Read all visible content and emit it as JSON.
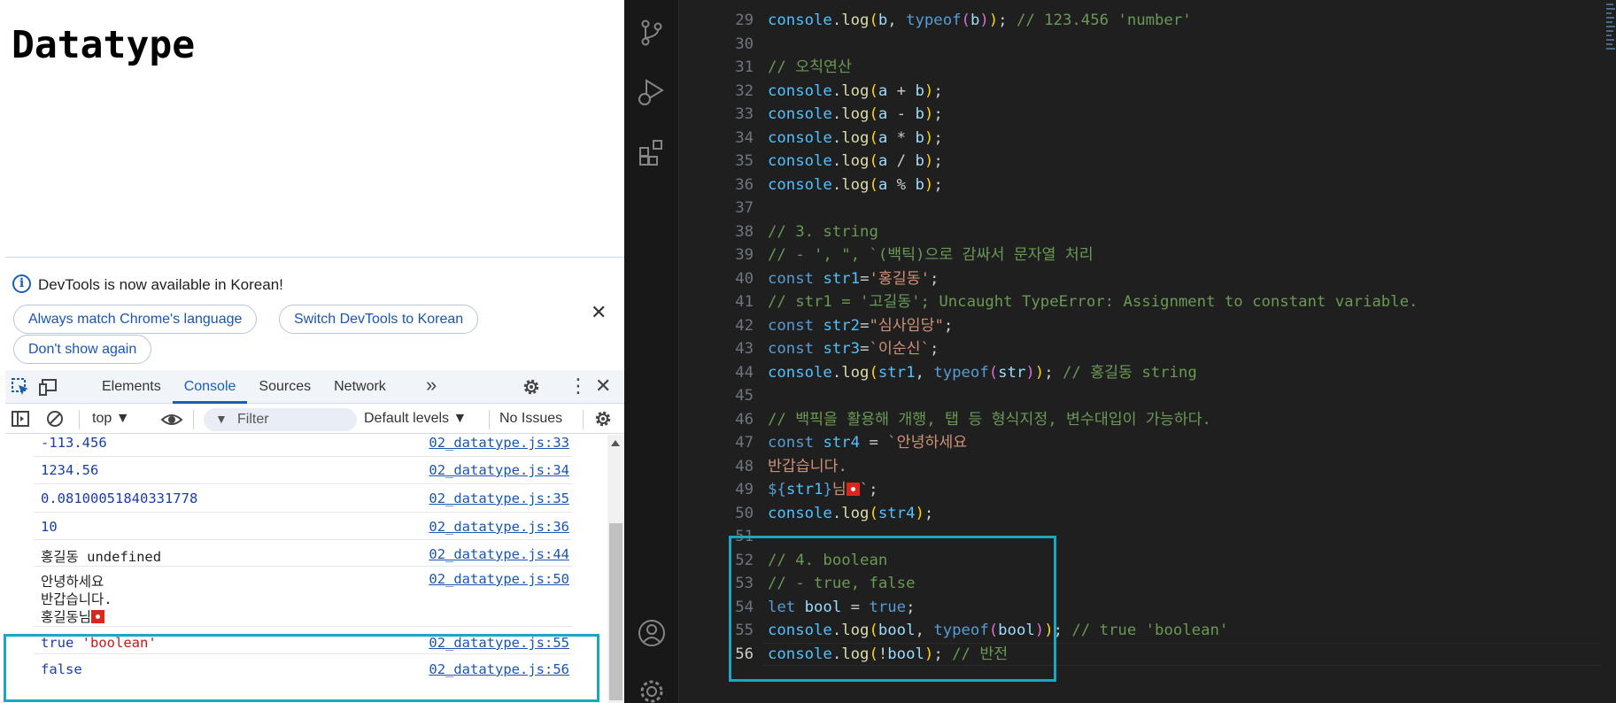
{
  "browser": {
    "page_heading": "Datatype"
  },
  "devtools": {
    "infobar": {
      "message": "DevTools is now available in Korean!",
      "btn_always": "Always match Chrome's language",
      "btn_switch": "Switch DevTools to Korean",
      "btn_dont": "Don't show again"
    },
    "tabs": [
      "Elements",
      "Console",
      "Sources",
      "Network"
    ],
    "active_tab": "Console",
    "filterbar": {
      "context": "top ▼",
      "filter_placeholder": "Filter",
      "levels": "Default levels ▼",
      "issues": "No Issues"
    },
    "console_rows": [
      {
        "text": "-113.456",
        "source": "02_datatype.js:33"
      },
      {
        "text": "1234.56",
        "source": "02_datatype.js:34"
      },
      {
        "text": "0.08100051840331778",
        "source": "02_datatype.js:35"
      },
      {
        "text": "10",
        "source": "02_datatype.js:36"
      },
      {
        "text": "홍길동 undefined",
        "source": "02_datatype.js:44"
      },
      {
        "line1": "안녕하세요",
        "line2": "반갑습니다.",
        "line3": "홍길동님",
        "source": "02_datatype.js:50"
      },
      {
        "text_bool": "true",
        "text_str": "'boolean'",
        "source": "02_datatype.js:55"
      },
      {
        "text": "false",
        "source": "02_datatype.js:56"
      }
    ]
  },
  "editor": {
    "lines": [
      {
        "n": "29",
        "html": "<span class='cv'>console</span>.<span class='fn'>log</span><span class='p1'>(</span><span class='vr'>b</span>, <span class='tp'>typeof</span><span class='p2'>(</span><span class='vr'>b</span><span class='p2'>)</span><span class='p1'>)</span>; <span class='cm'>// 123.456 'number'</span>"
      },
      {
        "n": "30",
        "html": ""
      },
      {
        "n": "31",
        "html": "<span class='cm'>// 오칙연산</span>"
      },
      {
        "n": "32",
        "html": "<span class='cv'>console</span>.<span class='fn'>log</span><span class='p1'>(</span><span class='vr'>a</span> + <span class='vr'>b</span><span class='p1'>)</span>;"
      },
      {
        "n": "33",
        "html": "<span class='cv'>console</span>.<span class='fn'>log</span><span class='p1'>(</span><span class='vr'>a</span> - <span class='vr'>b</span><span class='p1'>)</span>;"
      },
      {
        "n": "34",
        "html": "<span class='cv'>console</span>.<span class='fn'>log</span><span class='p1'>(</span><span class='vr'>a</span> * <span class='vr'>b</span><span class='p1'>)</span>;"
      },
      {
        "n": "35",
        "html": "<span class='cv'>console</span>.<span class='fn'>log</span><span class='p1'>(</span><span class='vr'>a</span> / <span class='vr'>b</span><span class='p1'>)</span>;"
      },
      {
        "n": "36",
        "html": "<span class='cv'>console</span>.<span class='fn'>log</span><span class='p1'>(</span><span class='vr'>a</span> % <span class='vr'>b</span><span class='p1'>)</span>;"
      },
      {
        "n": "37",
        "html": ""
      },
      {
        "n": "38",
        "html": "<span class='cm'>// 3. string</span>"
      },
      {
        "n": "39",
        "html": "<span class='cm'>// - ', \", `(백틱)으로 감싸서 문자열 처리</span>"
      },
      {
        "n": "40",
        "html": "<span class='kw'>const</span> <span class='cv'>str1</span>=<span class='st'>'홍길동'</span>;"
      },
      {
        "n": "41",
        "html": "<span class='cm'>// str1 = '고길동'; Uncaught TypeError: Assignment to constant variable.</span>"
      },
      {
        "n": "42",
        "html": "<span class='kw'>const</span> <span class='cv'>str2</span>=<span class='st'>\"심사임당\"</span>;"
      },
      {
        "n": "43",
        "html": "<span class='kw'>const</span> <span class='cv'>str3</span>=<span class='st'>`이순신`</span>;"
      },
      {
        "n": "44",
        "html": "<span class='cv'>console</span>.<span class='fn'>log</span><span class='p1'>(</span><span class='cv'>str1</span>, <span class='tp'>typeof</span><span class='p2'>(</span><span class='vr'>str</span><span class='p2'>)</span><span class='p1'>)</span>; <span class='cm'>// 홍길동 string</span>"
      },
      {
        "n": "45",
        "html": ""
      },
      {
        "n": "46",
        "html": "<span class='cm'>// 백픽을 활용해 개행, 탭 등 형식지정, 변수대입이 가능하다.</span>"
      },
      {
        "n": "47",
        "html": "<span class='kw'>const</span> <span class='cv'>str4</span> = <span class='st'>`안녕하세요</span>"
      },
      {
        "n": "48",
        "html": "<span class='st'>반갑습니다.</span>"
      },
      {
        "n": "49",
        "html": "<span class='kw'>${</span><span class='cv'>str1</span><span class='kw'>}</span><span class='st'>님</span><span class='flag'></span><span class='st'>`</span>;"
      },
      {
        "n": "50",
        "html": "<span class='cv'>console</span>.<span class='fn'>log</span><span class='p1'>(</span><span class='cv'>str4</span><span class='p1'>)</span>;"
      },
      {
        "n": "51",
        "html": ""
      },
      {
        "n": "52",
        "html": "<span class='cm'>// 4. boolean</span>"
      },
      {
        "n": "53",
        "html": "<span class='cm'>// - true, false</span>"
      },
      {
        "n": "54",
        "html": "<span class='kw'>let</span> <span class='vr'>bool</span> = <span class='kw'>true</span>;"
      },
      {
        "n": "55",
        "html": "<span class='cv'>console</span>.<span class='fn'>log</span><span class='p1'>(</span><span class='vr'>bool</span>, <span class='tp'>typeof</span><span class='p2'>(</span><span class='vr'>bool</span><span class='p2'>)</span><span class='p1'>)</span>; <span class='cm'>// true 'boolean'</span>"
      },
      {
        "n": "56",
        "html": "<span class='cv'>console</span>.<span class='fn'>log</span><span class='p1'>(</span>!<span class='vr'>bool</span><span class='p1'>)</span>; <span class='cm'>// 반전</span>"
      }
    ],
    "current_line": "56"
  },
  "colors": {
    "highlight_box": "#19a7c2",
    "active_tab": "#1a5fb4"
  }
}
